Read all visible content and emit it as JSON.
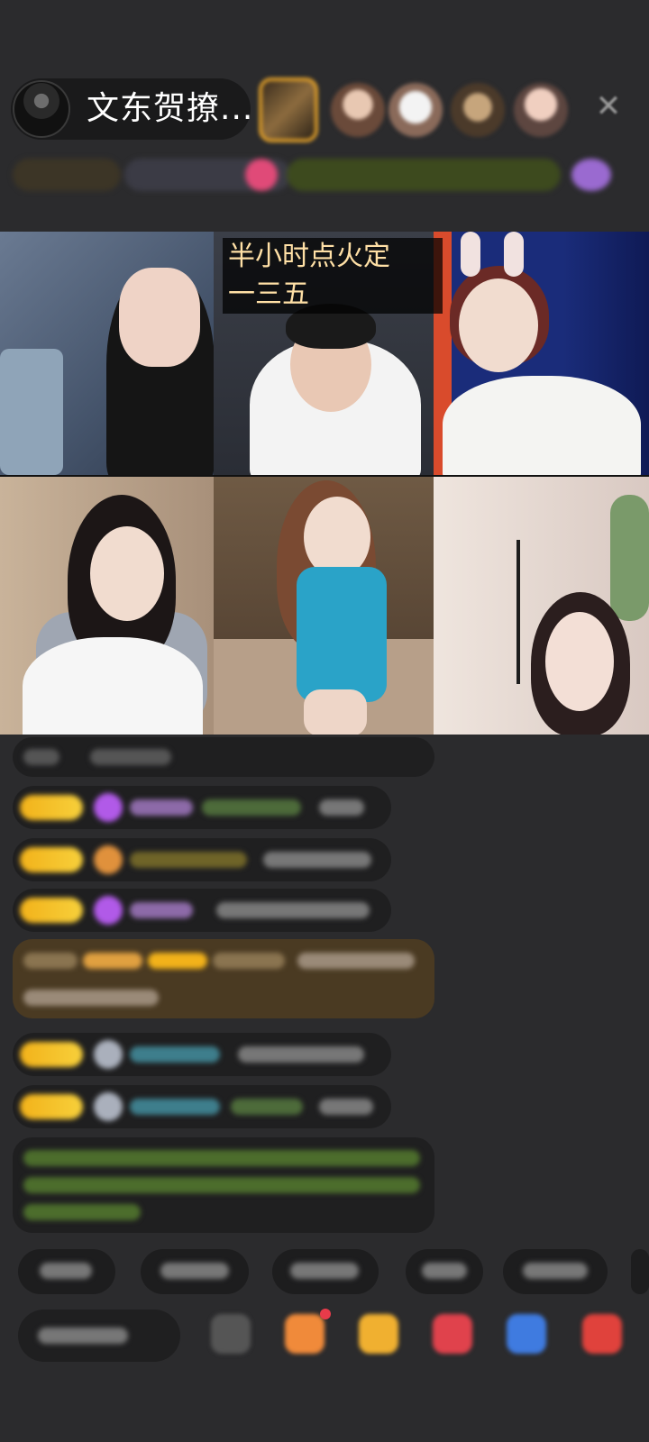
{
  "header": {
    "host_name": "文东贺撩...",
    "close_icon": "close-icon"
  },
  "video_grid": {
    "caption_line1": "半小时点火定",
    "caption_line2": "一三五"
  },
  "colors": {
    "background": "#2b2b2d",
    "badge": "#f2b21a",
    "caption_text": "#ffe0a6",
    "frame_gold": "#d89a2a"
  }
}
